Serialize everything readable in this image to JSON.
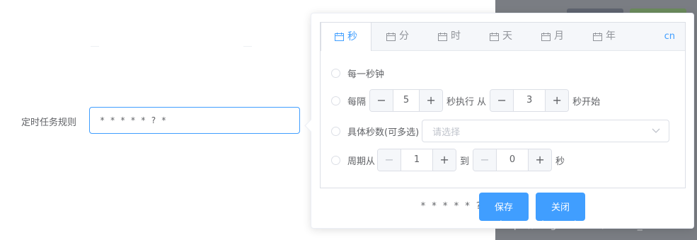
{
  "form": {
    "label": "定时任务规则",
    "cron_value": "* * * * * ? *"
  },
  "tabs": [
    {
      "label": "秒",
      "active": true
    },
    {
      "label": "分",
      "active": false
    },
    {
      "label": "时",
      "active": false
    },
    {
      "label": "天",
      "active": false
    },
    {
      "label": "月",
      "active": false
    },
    {
      "label": "年",
      "active": false
    }
  ],
  "language": "cn",
  "options": {
    "every": "每一秒钟",
    "interval": {
      "prefix": "每隔",
      "value1": "5",
      "middle": "秒执行 从",
      "value2": "3",
      "suffix": "秒开始"
    },
    "specific": {
      "label": "具体秒数(可多选)",
      "placeholder": "请选择"
    },
    "cycle": {
      "prefix": "周期从",
      "from": "1",
      "middle": "到",
      "to": "0",
      "suffix": "秒"
    }
  },
  "footer": {
    "expression": "* * * * * ? *",
    "save": "保存",
    "close": "关闭"
  },
  "watermark": "https://blog.csdn.net/weixin_49855580",
  "colors": {
    "accent": "#409eff",
    "text": "#606266",
    "border": "#dcdfe6"
  }
}
